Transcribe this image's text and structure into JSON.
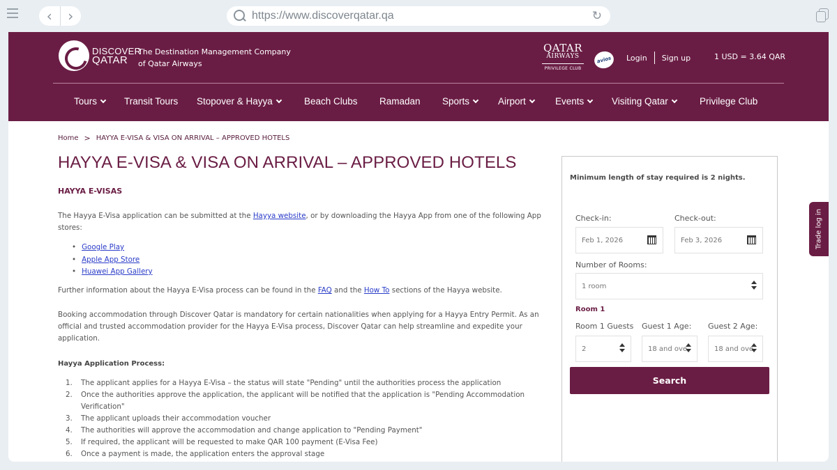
{
  "browser": {
    "url": "https://www.discoverqatar.qa"
  },
  "header": {
    "logo_line1": "DISCOVER",
    "logo_line2": "QATAR",
    "tagline_line1": "The Destination Management Company",
    "tagline_line2": "of Qatar Airways",
    "airline_line1": "QATAR",
    "airline_line2": "AIRWAYS",
    "airline_line3": "PRIVILEGE CLUB",
    "avios": "avios",
    "login": "Login",
    "signup": "Sign up",
    "currency": "1 USD = 3.64 QAR"
  },
  "nav": {
    "items": [
      {
        "label": "Tours",
        "dropdown": true
      },
      {
        "label": "Transit Tours",
        "dropdown": false
      },
      {
        "label": "Stopover & Hayya",
        "dropdown": true
      },
      {
        "label": "Beach Clubs",
        "dropdown": false
      },
      {
        "label": "Ramadan",
        "dropdown": false
      },
      {
        "label": "Sports",
        "dropdown": true
      },
      {
        "label": "Airport",
        "dropdown": true
      },
      {
        "label": "Events",
        "dropdown": true
      },
      {
        "label": "Visiting Qatar",
        "dropdown": true
      },
      {
        "label": "Privilege Club",
        "dropdown": false
      }
    ]
  },
  "content": {
    "breadcrumb_home": "Home",
    "breadcrumb_sep": ">",
    "breadcrumb_current": "HAYYA E-VISA & VISA ON ARRIVAL – APPROVED HOTELS",
    "title": "HAYYA E-VISA & VISA ON ARRIVAL – APPROVED HOTELS",
    "subtitle": "HAYYA E-VISAS",
    "p1_a": "The Hayya E-Visa application can be submitted at the ",
    "p1_link": "Hayya website",
    "p1_b": ", or by downloading the Hayya App from one of the following App stores:",
    "stores": [
      "Google Play",
      "Apple App Store ",
      "Huawei App Gallery"
    ],
    "p2_a": "Further information about the Hayya E-Visa process can be found in the ",
    "p2_link1": "FAQ",
    "p2_b": " and the ",
    "p2_link2": "How To",
    "p2_c": " sections of the Hayya website.",
    "p3": "Booking accommodation through Discover Qatar is mandatory for certain nationalities when applying for a Hayya Entry Permit. As an official and trusted accommodation provider for the Hayya E-Visa process, Discover Qatar can help streamline and expedite your application.",
    "process_title": "Hayya Application Process:",
    "steps": [
      "The applicant applies for a Hayya E-Visa – the status will state \"Pending\" until the authorities process the application",
      "Once the authorities approve the application, the applicant will be notified that the application is \"Pending Accommodation Verification\"",
      "The applicant uploads their accommodation voucher",
      "The authorities will approve the accommodation and change application to \"Pending Payment\"",
      "If required, the applicant will be requested to make QAR 100 payment (E-Visa Fee)",
      "Once a payment is made, the application enters the approval stage"
    ]
  },
  "booking": {
    "min_stay": "Minimum length of stay required is 2 nights.",
    "checkin_label": "Check-in:",
    "checkin_value": "Feb 1, 2026",
    "checkout_label": "Check-out:",
    "checkout_value": "Feb 3, 2026",
    "rooms_label": "Number of Rooms:",
    "rooms_value": "1 room",
    "room_heading": "Room 1",
    "guests_label": "Room 1 Guests",
    "guests_value": "2",
    "guest1_label": "Guest 1 Age:",
    "guest1_value": "18 and ove",
    "guest2_label": "Guest 2 Age:",
    "guest2_value": "18 and ove",
    "search": "Search"
  },
  "side_tab": "Trade log in",
  "colors": {
    "brand": "#6a1d44",
    "link": "#2a3cc8"
  }
}
